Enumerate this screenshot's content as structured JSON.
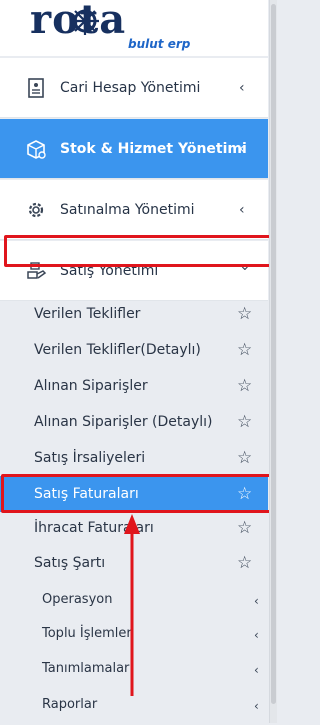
{
  "brand": {
    "name": "rota",
    "subtitle": "bulut erp"
  },
  "sidebar": {
    "items": [
      {
        "label": "Cari Hesap Yönetimi",
        "icon": "ledger-icon",
        "chevron": "‹",
        "active": false
      },
      {
        "label": "Stok & Hizmet Yönetimi",
        "icon": "box-icon",
        "chevron": "‹",
        "active": true
      },
      {
        "label": "Satınalma Yönetimi",
        "icon": "gear-icon",
        "chevron": "‹",
        "active": false
      },
      {
        "label": "Satış Yönetimi",
        "icon": "sales-icon",
        "chevron": "⌄",
        "active": false
      }
    ]
  },
  "sales_submenu": {
    "items": [
      {
        "label": "Verilen Teklifler"
      },
      {
        "label": "Verilen Teklifler(Detaylı)"
      },
      {
        "label": "Alınan Siparişler"
      },
      {
        "label": "Alınan Siparişler (Detaylı)"
      },
      {
        "label": "Satış İrsaliyeleri"
      },
      {
        "label": "Satış Faturaları"
      },
      {
        "label": "İhracat Faturaları"
      },
      {
        "label": "Satış Şartı"
      }
    ],
    "star": "☆",
    "groups": [
      {
        "label": "Operasyon",
        "chevron": "‹"
      },
      {
        "label": "Toplu İşlemler",
        "chevron": "‹"
      },
      {
        "label": "Tanımlamalar",
        "chevron": "‹"
      },
      {
        "label": "Raporlar",
        "chevron": "‹"
      }
    ]
  },
  "colors": {
    "active": "#3b95ee",
    "highlight": "#e0151c",
    "sidebar_bg": "#e9ecf1"
  }
}
